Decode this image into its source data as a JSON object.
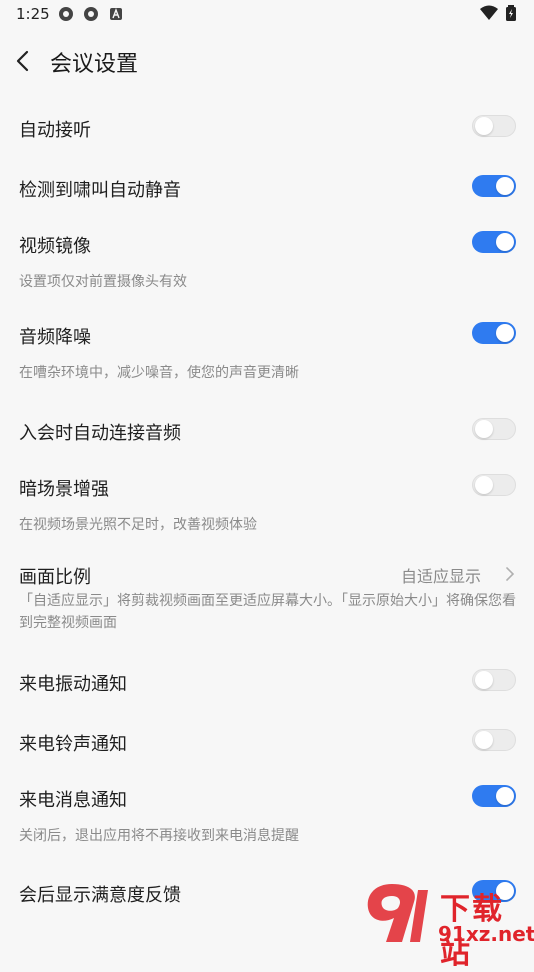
{
  "status_bar": {
    "time": "1:25"
  },
  "header": {
    "title": "会议设置"
  },
  "settings": [
    {
      "label": "自动接听",
      "toggle": false
    },
    {
      "label": "检测到啸叫自动静音",
      "toggle": true
    },
    {
      "label": "视频镜像",
      "toggle": true,
      "desc": "设置项仅对前置摄像头有效"
    },
    {
      "label": "音频降噪",
      "toggle": true,
      "desc": "在嘈杂环境中，减少噪音，使您的声音更清晰"
    },
    {
      "label": "入会时自动连接音频",
      "toggle": false
    },
    {
      "label": "暗场景增强",
      "toggle": false,
      "desc": "在视频场景光照不足时，改善视频体验"
    },
    {
      "label": "画面比例",
      "value": "自适应显示",
      "desc": "「自适应显示」将剪裁视频画面至更适应屏幕大小。「显示原始大小」将确保您看到完整视频画面"
    },
    {
      "label": "来电振动通知",
      "toggle": false
    },
    {
      "label": "来电铃声通知",
      "toggle": false
    },
    {
      "label": "来电消息通知",
      "toggle": true,
      "desc": "关闭后，退出应用将不再接收到来电消息提醒"
    },
    {
      "label": "会后显示满意度反馈",
      "toggle": true
    }
  ],
  "watermark": {
    "text1": "下载站",
    "text2": "91xz.net"
  },
  "colors": {
    "accent": "#2f7bf0",
    "toggle_off": "#ececec",
    "background": "#f7f7f7",
    "watermark": "#e0242b"
  }
}
